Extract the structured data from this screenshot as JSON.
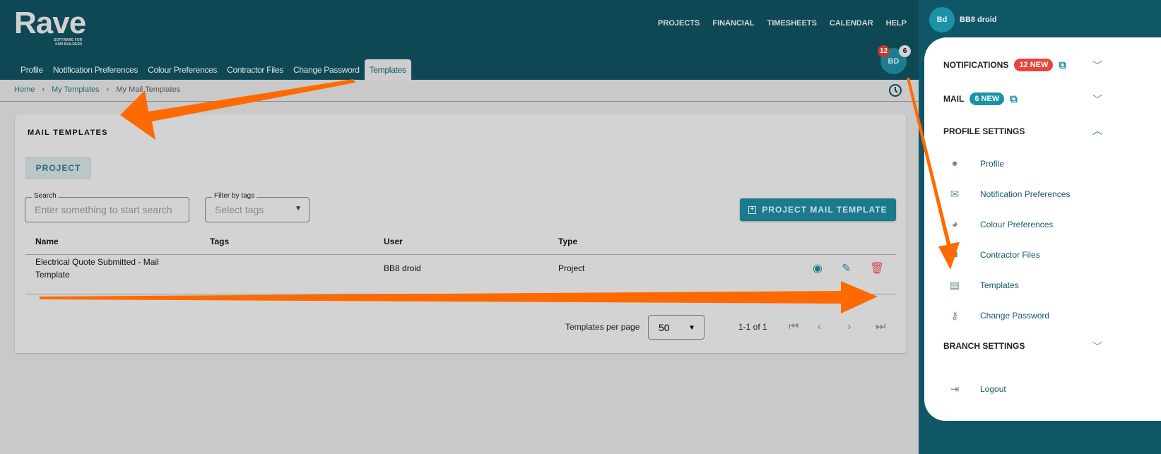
{
  "logo": {
    "name": "Rave",
    "tagline1": "SOFTWARE FOR",
    "tagline2": "KIWI BUILDERS"
  },
  "topnav": [
    "PROJECTS",
    "FINANCIAL",
    "TIMESHEETS",
    "CALENDAR",
    "HELP"
  ],
  "tabs": [
    "Profile",
    "Notification Preferences",
    "Colour Preferences",
    "Contractor Files",
    "Change Password",
    "Templates"
  ],
  "avatar": {
    "initials": "BD",
    "notif_count": "12",
    "mail_count": "6"
  },
  "breadcrumb": [
    "Home",
    "My Templates",
    "My Mail Templates"
  ],
  "card": {
    "title": "MAIL TEMPLATES",
    "project_button": "PROJECT",
    "search_label": "Search",
    "search_placeholder": "Enter something to start search",
    "filter_label": "Filter by tags",
    "filter_placeholder": "Select tags",
    "add_button": "PROJECT MAIL TEMPLATE"
  },
  "table": {
    "headers": [
      "Name",
      "Tags",
      "User",
      "Type"
    ],
    "rows": [
      {
        "name": "Electrical Quote Submitted - Mail Template",
        "tags": "",
        "user": "BB8 droid",
        "type": "Project"
      }
    ]
  },
  "pagination": {
    "label": "Templates per page",
    "per_page": "50",
    "range": "1-1 of 1"
  },
  "drawer": {
    "initials": "Bd",
    "user": "BB8 droid",
    "notifications": "NOTIFICATIONS",
    "notifications_badge": "12 NEW",
    "mail": "MAIL",
    "mail_badge": "6 NEW",
    "profile_settings": "PROFILE SETTINGS",
    "items": [
      "Profile",
      "Notification Preferences",
      "Colour Preferences",
      "Contractor Files",
      "Templates",
      "Change Password"
    ],
    "branch_settings": "BRANCH SETTINGS",
    "logout": "Logout"
  },
  "colors": {
    "header": "#0e4855",
    "accent": "#1b7a8c",
    "danger": "#e53935",
    "annotation": "#ff6a00"
  }
}
